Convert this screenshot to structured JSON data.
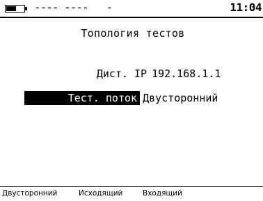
{
  "status_bar": {
    "battery_icon": "battery-icon",
    "battery_level": 0.6,
    "indicators": "---- ----   -",
    "clock": "11:04"
  },
  "screen": {
    "title": "Топология тестов",
    "remote_ip_label": "Дист. IP",
    "remote_ip_value": "192.168.1.1",
    "test_flow_label": "Тест. поток",
    "test_flow_value": "Двусторонний"
  },
  "softkeys": [
    {
      "label": "Двусторонний"
    },
    {
      "label": "Исходящий"
    },
    {
      "label": "Входящий"
    }
  ],
  "colors": {
    "background": "#ffffff",
    "foreground": "#000000",
    "highlight_bg": "#000000",
    "highlight_fg": "#ffffff"
  }
}
